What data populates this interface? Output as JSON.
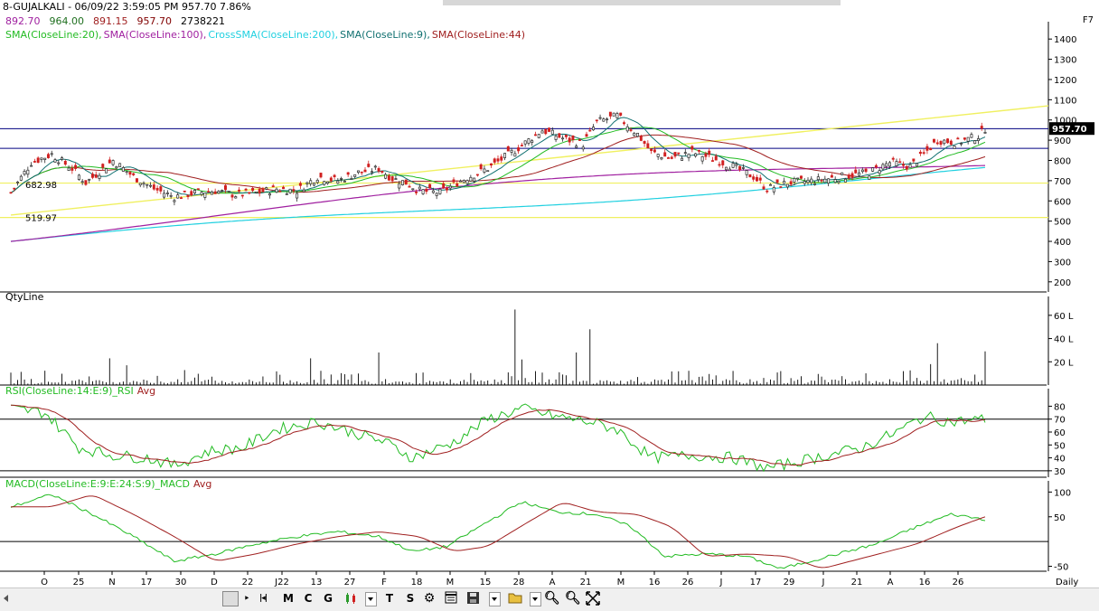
{
  "window": {
    "title": "8-GUJALKALI - 06/09/22 3:59:05 PM 957.70 7.86%",
    "shortcut": "F7"
  },
  "ohlc": {
    "open": "892.70",
    "high": "964.00",
    "low": "891.15",
    "close": "957.70",
    "volume": "2738221"
  },
  "colors": {
    "open": "#a020a0",
    "high": "#207020",
    "low": "#a02020",
    "close": "#800000",
    "volume": "#000000",
    "up_candle": "#2a2a2a",
    "down_candle": "#d02020",
    "sma20": "#22bb22",
    "sma100": "#a020a0",
    "sma200": "#20d0e0",
    "sma9": "#107070",
    "sma44": "#a02020",
    "trend": "#f0f060",
    "hline": "#000080"
  },
  "legend": [
    {
      "label": "SMA(CloseLine:20),",
      "color": "#22bb22"
    },
    {
      "label": "SMA(CloseLine:100),",
      "color": "#a020a0"
    },
    {
      "label": "CrossSMA(CloseLine:200),",
      "color": "#20d0e0"
    },
    {
      "label": "SMA(CloseLine:9),",
      "color": "#107070"
    },
    {
      "label": "SMA(CloseLine:44)",
      "color": "#a02020"
    }
  ],
  "price_axis": {
    "ticks": [
      "1400",
      "1300",
      "1200",
      "1100",
      "1000",
      "900",
      "800",
      "700",
      "600",
      "500",
      "400",
      "300",
      "200"
    ],
    "current": "957.70",
    "annotations": [
      "682.98",
      "519.97"
    ]
  },
  "volume_panel": {
    "label": "QtyLine",
    "ticks": [
      "60 L",
      "40 L",
      "20 L"
    ]
  },
  "rsi_panel": {
    "label": "RSI(CloseLine:14:E:9)_RSI",
    "avg": "Avg",
    "ticks": [
      "80",
      "70",
      "60",
      "50",
      "40",
      "30"
    ]
  },
  "macd_panel": {
    "label": "MACD(CloseLine:E:9:E:24:S:9)_MACD",
    "avg": "Avg",
    "ticks": [
      "100",
      "50",
      "-50"
    ]
  },
  "x_axis": {
    "labels": [
      "O",
      "25",
      "N",
      "17",
      "30",
      "D",
      "22",
      "J22",
      "13",
      "27",
      "F",
      "18",
      "M",
      "15",
      "28",
      "A",
      "21",
      "M",
      "16",
      "26",
      "J",
      "17",
      "29",
      "J",
      "21",
      "A",
      "16",
      "26"
    ],
    "unit": "Daily"
  },
  "toolbar": {
    "buttons": [
      "M",
      "C",
      "G",
      "T",
      "S"
    ]
  },
  "chart_data": {
    "type": "candlestick",
    "title": "8-GUJALKALI - 06/09/22 3:59:05 PM 957.70 7.86%",
    "ylim": [
      150,
      1450
    ],
    "close_anchors": [
      [
        0,
        640
      ],
      [
        6,
        790
      ],
      [
        12,
        830
      ],
      [
        18,
        760
      ],
      [
        22,
        690
      ],
      [
        30,
        800
      ],
      [
        36,
        720
      ],
      [
        42,
        660
      ],
      [
        48,
        620
      ],
      [
        54,
        640
      ],
      [
        60,
        650
      ],
      [
        66,
        630
      ],
      [
        72,
        640
      ],
      [
        78,
        660
      ],
      [
        84,
        650
      ],
      [
        90,
        720
      ],
      [
        96,
        700
      ],
      [
        102,
        740
      ],
      [
        108,
        760
      ],
      [
        112,
        710
      ],
      [
        116,
        690
      ],
      [
        120,
        650
      ],
      [
        126,
        640
      ],
      [
        132,
        700
      ],
      [
        140,
        760
      ],
      [
        148,
        850
      ],
      [
        156,
        950
      ],
      [
        162,
        910
      ],
      [
        168,
        880
      ],
      [
        172,
        990
      ],
      [
        178,
        1020
      ],
      [
        184,
        930
      ],
      [
        188,
        840
      ],
      [
        194,
        810
      ],
      [
        200,
        840
      ],
      [
        206,
        810
      ],
      [
        212,
        770
      ],
      [
        218,
        720
      ],
      [
        222,
        660
      ],
      [
        228,
        690
      ],
      [
        236,
        700
      ],
      [
        244,
        720
      ],
      [
        252,
        740
      ],
      [
        258,
        790
      ],
      [
        264,
        770
      ],
      [
        268,
        830
      ],
      [
        272,
        900
      ],
      [
        278,
        890
      ],
      [
        284,
        920
      ],
      [
        286,
        958
      ]
    ],
    "rsi_anchors": [
      [
        0,
        78
      ],
      [
        10,
        75
      ],
      [
        20,
        48
      ],
      [
        30,
        42
      ],
      [
        40,
        40
      ],
      [
        48,
        34
      ],
      [
        58,
        45
      ],
      [
        68,
        48
      ],
      [
        78,
        62
      ],
      [
        90,
        68
      ],
      [
        100,
        60
      ],
      [
        110,
        52
      ],
      [
        118,
        40
      ],
      [
        130,
        52
      ],
      [
        140,
        70
      ],
      [
        150,
        78
      ],
      [
        160,
        72
      ],
      [
        170,
        68
      ],
      [
        178,
        62
      ],
      [
        188,
        40
      ],
      [
        200,
        42
      ],
      [
        212,
        40
      ],
      [
        222,
        32
      ],
      [
        236,
        40
      ],
      [
        250,
        48
      ],
      [
        260,
        60
      ],
      [
        268,
        72
      ],
      [
        276,
        68
      ],
      [
        286,
        70
      ]
    ],
    "macd_anchors": [
      [
        0,
        70
      ],
      [
        12,
        95
      ],
      [
        24,
        55
      ],
      [
        36,
        10
      ],
      [
        48,
        -40
      ],
      [
        60,
        -25
      ],
      [
        72,
        -5
      ],
      [
        84,
        10
      ],
      [
        96,
        20
      ],
      [
        108,
        10
      ],
      [
        118,
        -20
      ],
      [
        128,
        -10
      ],
      [
        140,
        40
      ],
      [
        150,
        80
      ],
      [
        160,
        60
      ],
      [
        172,
        55
      ],
      [
        182,
        30
      ],
      [
        192,
        -30
      ],
      [
        204,
        -25
      ],
      [
        216,
        -30
      ],
      [
        226,
        -55
      ],
      [
        240,
        -30
      ],
      [
        254,
        -5
      ],
      [
        266,
        30
      ],
      [
        276,
        55
      ],
      [
        286,
        45
      ]
    ],
    "volume_spikes": [
      [
        148,
        65
      ],
      [
        150,
        22
      ],
      [
        154,
        12
      ],
      [
        170,
        48
      ],
      [
        166,
        28
      ],
      [
        29,
        23
      ],
      [
        34,
        17
      ],
      [
        88,
        23
      ],
      [
        108,
        28
      ],
      [
        272,
        36
      ],
      [
        286,
        29
      ],
      [
        262,
        12
      ],
      [
        270,
        18
      ]
    ]
  }
}
